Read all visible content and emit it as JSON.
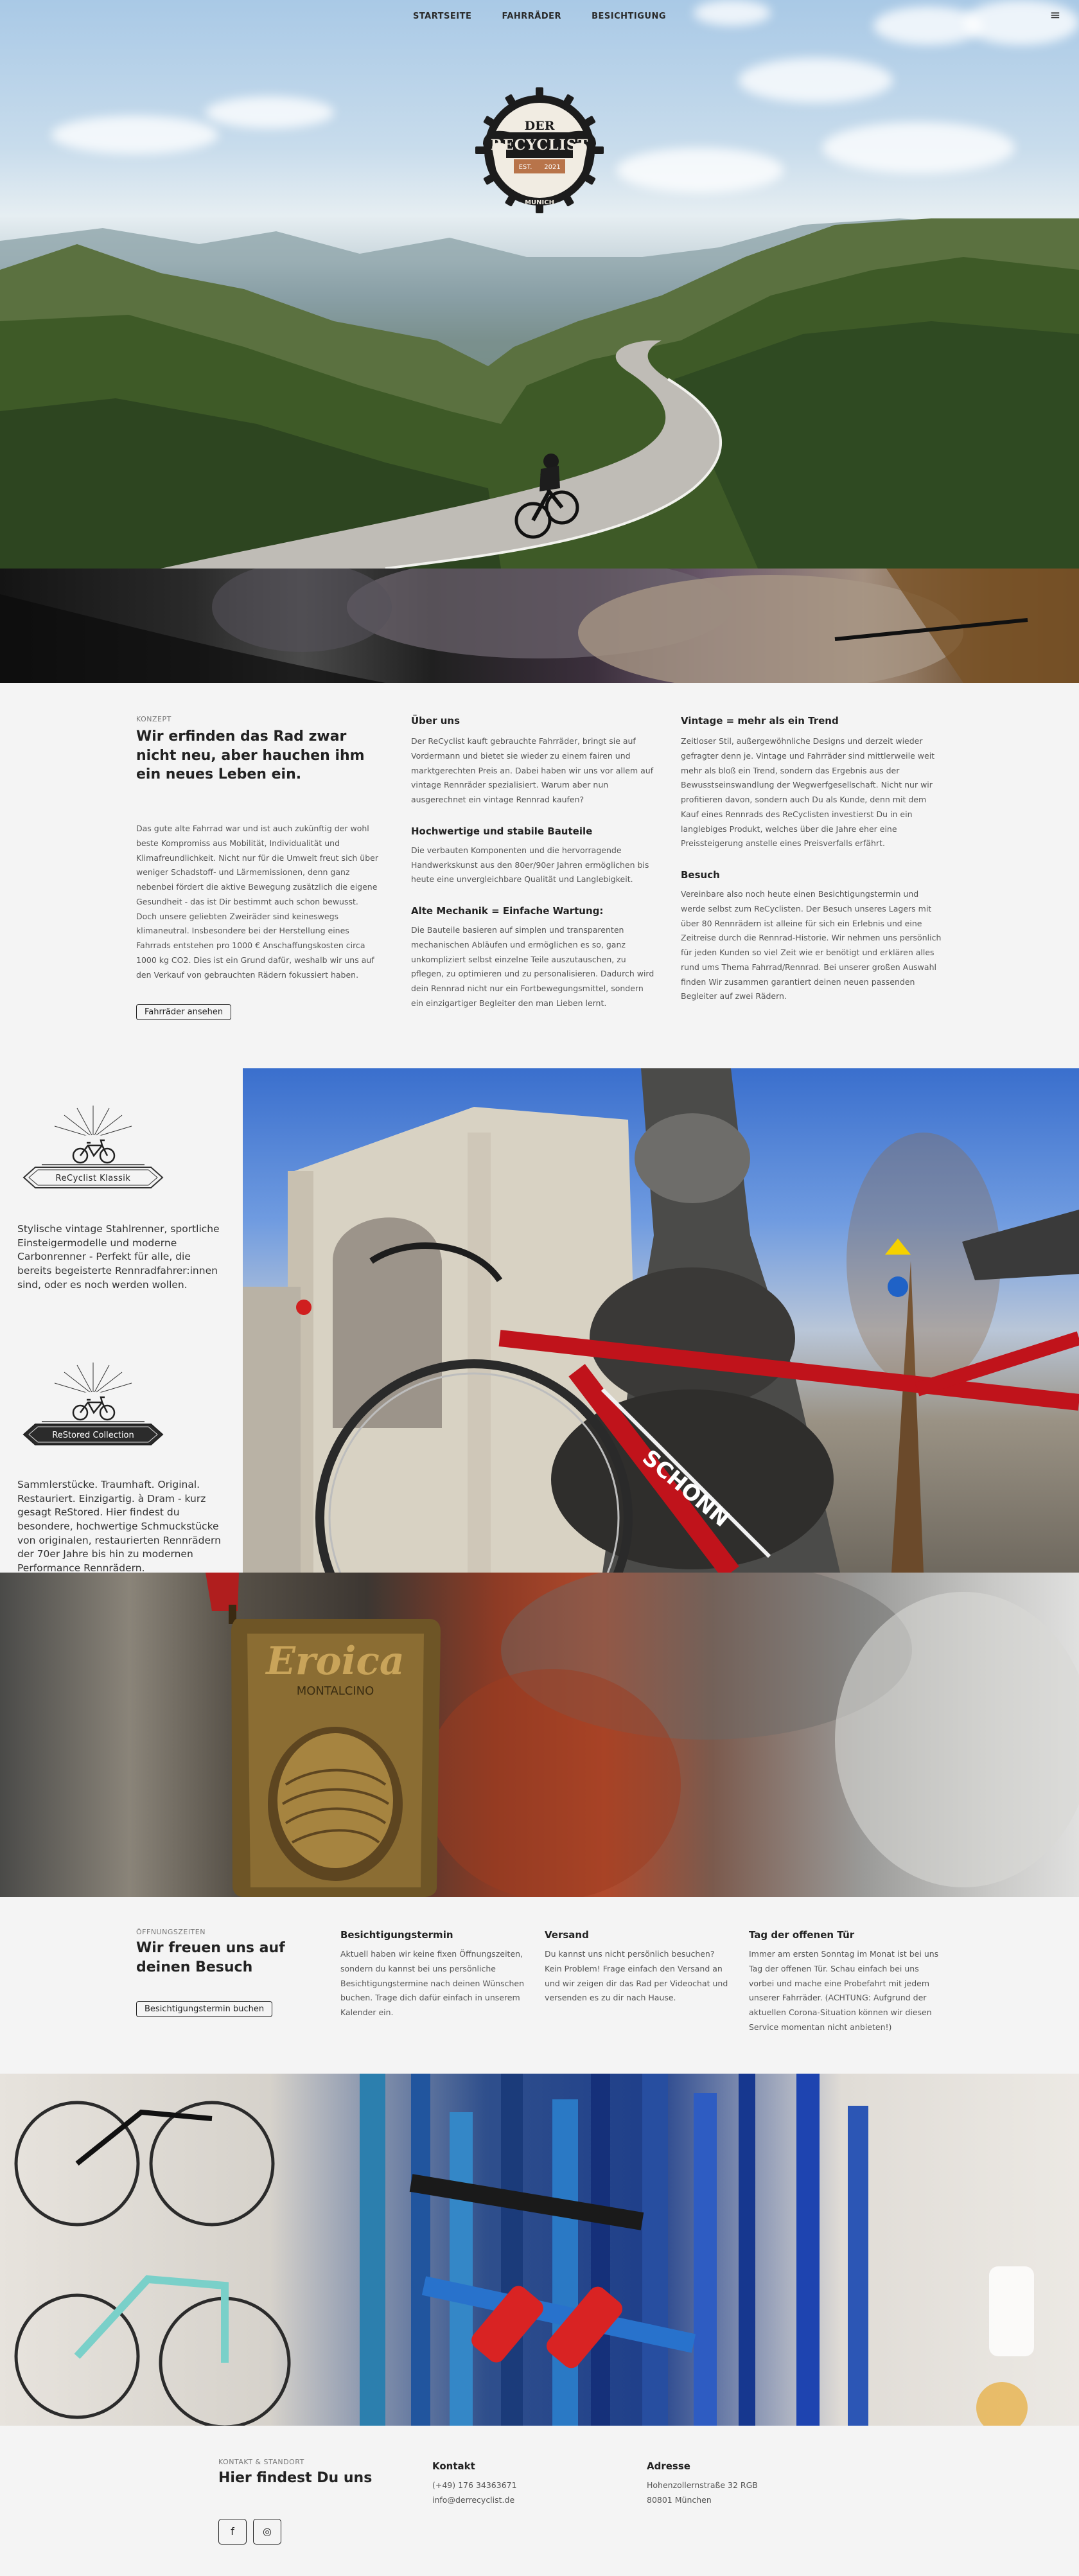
{
  "nav": {
    "items": [
      "STARTSEITE",
      "FAHRRÄDER",
      "BESICHTIGUNG"
    ],
    "menu_icon": "hamburger-icon"
  },
  "logo": {
    "line1": "DER",
    "line2": "RECYCLIST",
    "est": "EST.",
    "year": "2021",
    "city": "MUNICH"
  },
  "konzept": {
    "label": "KONZEPT",
    "title": "Wir erfinden das Rad zwar nicht neu, aber hauchen ihm ein neues Leben ein.",
    "body": "Das gute alte Fahrrad war und ist auch zukünftig der wohl beste Kompromiss aus Mobilität, Individualität und Klimafreundlichkeit. Nicht nur für die Umwelt freut sich über weniger Schadstoff- und Lärmemissionen, denn ganz nebenbei fördert die aktive Bewegung zusätzlich die eigene Gesundheit - das ist Dir bestimmt auch schon bewusst. Doch unsere geliebten Zweiräder sind keineswegs klimaneutral. Insbesondere bei der Herstellung eines Fahrrads entstehen pro 1000 € Anschaffungskosten circa 1000 kg CO2. Dies ist ein Grund dafür, weshalb wir uns auf den Verkauf von gebrauchten Rädern fokussiert haben.",
    "button": "Fahrräder ansehen",
    "col2": [
      {
        "title": "Über uns",
        "text": "Der ReCyclist kauft gebrauchte Fahrräder, bringt sie auf Vordermann und bietet sie wieder zu einem fairen und marktgerechten Preis an. Dabei haben wir uns vor allem auf vintage Rennräder spezialisiert. Warum aber nun ausgerechnet ein vintage Rennrad kaufen?"
      },
      {
        "title": "Hochwertige und stabile Bauteile",
        "text": "Die verbauten Komponenten und die hervorragende Handwerkskunst aus den 80er/90er Jahren ermöglichen bis heute eine unvergleichbare Qualität und Langlebigkeit."
      },
      {
        "title": "Alte Mechanik = Einfache Wartung:",
        "text": "Die Bauteile basieren auf simplen und transparenten mechanischen Abläufen und ermöglichen es so, ganz unkompliziert selbst einzelne Teile auszutauschen, zu pflegen, zu optimieren und zu personalisieren. Dadurch wird dein Rennrad nicht nur ein Fortbewegungsmittel, sondern ein einzigartiger Begleiter den man Lieben lernt."
      }
    ],
    "col3": [
      {
        "title": "Vintage = mehr als ein Trend",
        "text": "Zeitloser Stil, außergewöhnliche Designs und derzeit wieder gefragter denn je. Vintage und Fahrräder sind mittlerweile weit mehr als bloß ein Trend, sondern das Ergebnis aus der Bewusstseinswandlung der Wegwerfgesellschaft. Nicht nur wir profitieren davon, sondern auch Du als Kunde, denn mit dem Kauf eines Rennrads des ReCyclisten investierst Du in ein langlebiges Produkt, welches über die Jahre eher eine Preissteigerung anstelle eines Preisverfalls erfährt."
      },
      {
        "title": "Besuch",
        "text": "Vereinbare also noch heute einen Besichtigungstermin und werde selbst zum ReCyclisten. Der Besuch unseres Lagers mit über 80 Rennrädern ist alleine für sich ein Erlebnis und eine Zeitreise durch die Rennrad-Historie. Wir nehmen uns persönlich für jeden Kunden so viel Zeit wie er benötigt und erklären alles rund ums Thema Fahrrad/Rennrad. Bei unserer großen Auswahl finden Wir zusammen garantiert deinen neuen passenden Begleiter auf zwei Rädern."
      }
    ]
  },
  "collections": [
    {
      "badge": "ReCyclist Klassik",
      "text": "Stylische vintage Stahlrenner, sportliche Einsteigermodelle und moderne Carbonrenner - Perfekt für alle, die bereits begeisterte Rennradfahrer:innen sind, oder es noch werden wollen."
    },
    {
      "badge": "ReStored Collection",
      "text": "Sammlerstücke. Traumhaft. Original. Restauriert. Einzigartig. à Dram - kurz gesagt ReStored. Hier findest du besondere, hochwertige Schmuckstücke von originalen, restaurierten Rennrädern der 70er Jahre bis hin zu modernen Performance Rennrädern."
    }
  ],
  "photos": {
    "bike_frame_text": "SCHONN",
    "medal_line1": "Eroica",
    "medal_line2": "MONTALCINO"
  },
  "oeffnungszeiten": {
    "label": "ÖFFNUNGSZEITEN",
    "title": "Wir freuen uns auf deinen Besuch",
    "button": "Besichtigungstermin buchen",
    "columns": [
      {
        "title": "Besichtigungstermin",
        "text": "Aktuell haben wir keine fixen Öffnungszeiten, sondern du kannst bei uns persönliche Besichtigungstermine nach deinen Wünschen buchen. Trage dich dafür einfach in unserem Kalender ein."
      },
      {
        "title": "Versand",
        "text": "Du kannst uns nicht persönlich besuchen? Kein Problem! Frage einfach den Versand an und wir zeigen dir das Rad per Videochat und versenden es zu dir nach Hause."
      },
      {
        "title": "Tag der offenen Tür",
        "text": "Immer am ersten Sonntag im Monat ist bei uns Tag der offenen Tür. Schau einfach bei uns vorbei und mache eine Probefahrt mit jedem unserer Fahrräder. (ACHTUNG: Aufgrund der aktuellen Corona-Situation können wir diesen Service momentan nicht anbieten!)"
      }
    ]
  },
  "footer": {
    "label": "KONTAKT & STANDORT",
    "title": "Hier findest Du uns",
    "kontakt_title": "Kontakt",
    "phone": "(+49) 176 34363671",
    "email": "info@derrecyclist.de",
    "adresse_title": "Adresse",
    "street": "Hohenzollernstraße 32 RGB",
    "city": "80801 München",
    "social": [
      {
        "icon": "facebook-icon",
        "glyph": "f"
      },
      {
        "icon": "instagram-icon",
        "glyph": "◎"
      }
    ]
  }
}
